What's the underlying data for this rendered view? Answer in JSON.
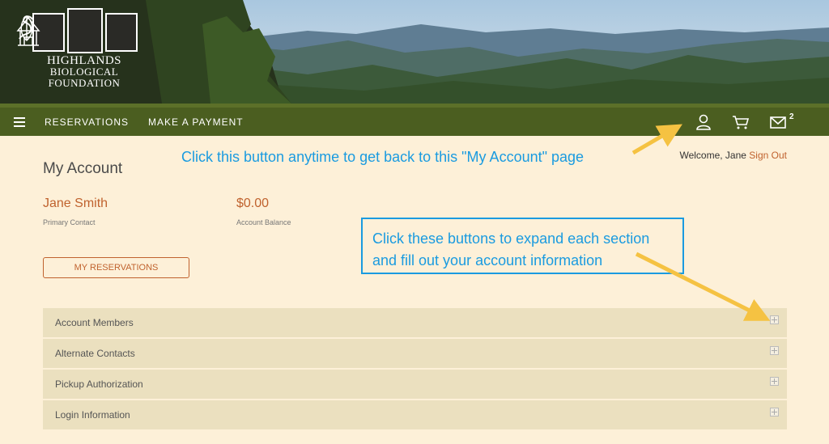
{
  "header": {
    "logo_title": "HIGHLANDS",
    "logo_subtitle": "BIOLOGICAL FOUNDATION"
  },
  "nav": {
    "items": [
      {
        "label": "RESERVATIONS"
      },
      {
        "label": "MAKE A PAYMENT"
      }
    ],
    "icons": [
      "user-icon",
      "cart-icon",
      "mail-icon"
    ],
    "message_count": "2"
  },
  "account": {
    "title": "My Account",
    "welcome": "Welcome, Jane",
    "sign_out": "Sign Out",
    "name": "Jane Smith",
    "name_caption": "Primary Contact",
    "balance": "$0.00",
    "balance_caption": "Account Balance",
    "reservations_button": "MY RESERVATIONS"
  },
  "sections": [
    {
      "label": "Account Members"
    },
    {
      "label": "Alternate Contacts"
    },
    {
      "label": "Pickup Authorization"
    },
    {
      "label": "Login Information"
    }
  ],
  "annotations": {
    "note_account": "Click this button anytime to get back to this \"My Account\" page",
    "note_expand_line1": "Click these buttons to expand each section",
    "note_expand_line2": "and fill out your account information"
  },
  "colors": {
    "nav_bg": "#4b5e20",
    "page_bg": "#fdf0d8",
    "accent": "#c0622e",
    "annotation": "#1a9be0",
    "arrow": "#f5c242"
  }
}
